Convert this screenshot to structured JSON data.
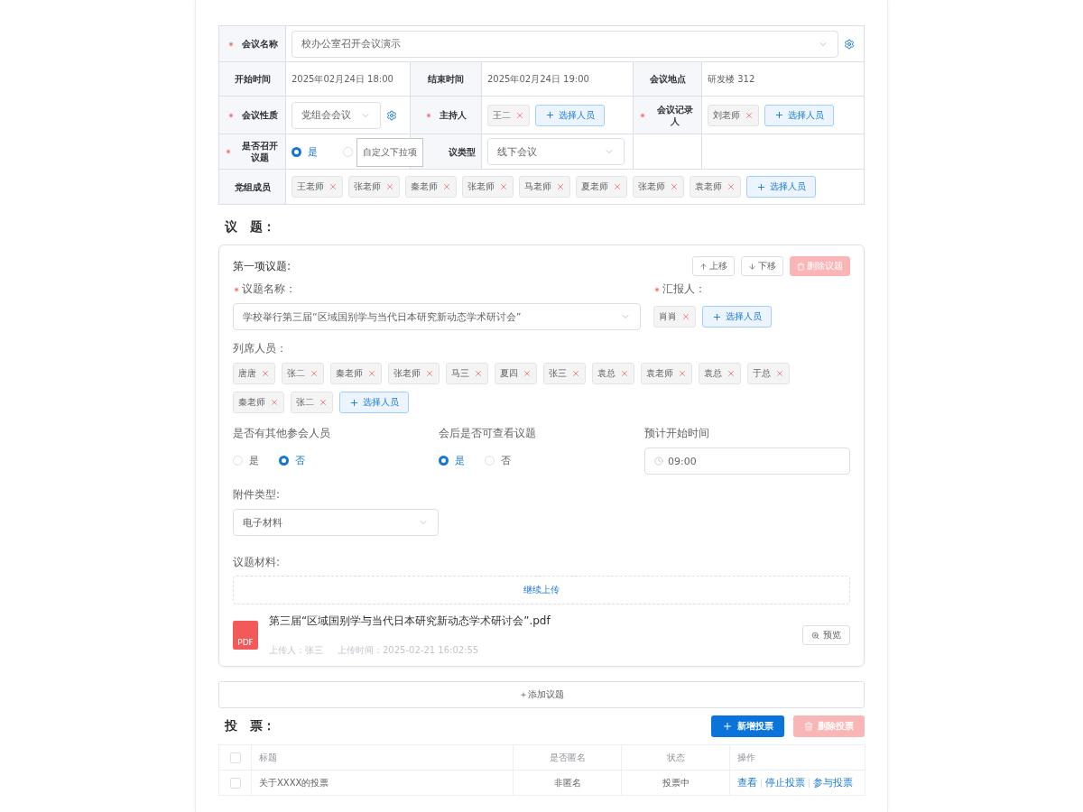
{
  "meeting": {
    "name": {
      "label": "会议名称",
      "required": true,
      "value": "校办公室召开会议演示"
    },
    "start_time": {
      "label": "开始时间",
      "value": "2025年02月24日 18:00"
    },
    "end_time": {
      "label": "结束时间",
      "value": "2025年02月24日 19:00"
    },
    "location": {
      "label": "会议地点",
      "value": "研发楼 312"
    },
    "nature": {
      "label": "会议性质",
      "required": true,
      "value": "党组会会议"
    },
    "host": {
      "label": "主持人",
      "required": true,
      "tags": [
        "王二"
      ],
      "button": "选择人员"
    },
    "recorder": {
      "label": "会议记录人",
      "required": true,
      "tags": [
        "刘老师"
      ],
      "button": "选择人员"
    },
    "has_topics": {
      "label": "是否召开议题",
      "required": true,
      "options": [
        {
          "label": "是",
          "selected": true
        },
        {
          "selected": false
        }
      ]
    },
    "tooltip": "自定义下拉项",
    "meeting_type": {
      "label": "议类型",
      "value": "线下会议"
    },
    "members": {
      "label": "党组成员",
      "tags": [
        "王老师",
        "张老师",
        "秦老师",
        "张老师",
        "马老师",
        "夏老师",
        "张老师",
        "袁老师"
      ],
      "button": "选择人员"
    }
  },
  "topics_heading": "议　题：",
  "topic": {
    "title": "第一项议题:",
    "buttons": [
      {
        "label": "上移",
        "kind": "up",
        "disabled": false
      },
      {
        "label": "下移",
        "kind": "down",
        "disabled": false
      },
      {
        "label": "删除议题",
        "kind": "delete",
        "disabled": true
      }
    ],
    "topic_name": {
      "label": "议题名称：",
      "required": true,
      "value": "学校举行第三届“区域国别学与当代日本研究新动态学术研讨会”"
    },
    "reporter": {
      "label": "汇报人：",
      "required": true,
      "tags": [
        "肖肖"
      ],
      "button": "选择人员"
    },
    "attendees": {
      "label": "列席人员：",
      "tags": [
        "唐唐",
        "张二",
        "秦老师",
        "张老师",
        "马三",
        "夏四",
        "张三",
        "袁总",
        "袁老师",
        "袁总",
        "于总",
        "秦老师",
        "张二"
      ],
      "button": "选择人员"
    },
    "other_attendees": {
      "label": "是否有其他参会人员",
      "options": [
        {
          "label": "是",
          "selected": false
        },
        {
          "label": "否",
          "selected": true
        }
      ]
    },
    "viewable": {
      "label": "会后是否可查看议题",
      "options": [
        {
          "label": "是",
          "selected": true
        },
        {
          "label": "否",
          "selected": false
        }
      ]
    },
    "planned_start": {
      "label": "预计开始时间",
      "value": "09:00"
    },
    "attachment_type": {
      "label": "附件类型:",
      "value": "电子材料"
    },
    "materials": {
      "label": "议题材料:",
      "upload": "继续上传",
      "file": {
        "badge": "PDF",
        "name": "第三届“区域国别学与当代日本研究新动态学术研讨会”.pdf",
        "uploader": "上传人：张三",
        "upload_time": "上传时间：2025-02-21 16:02:55",
        "preview": "预览"
      }
    }
  },
  "add_topic": "＋添加议题",
  "votes": {
    "heading": "投　票：",
    "buttons": [
      {
        "label": "新增投票",
        "kind": "add",
        "disabled": false
      },
      {
        "label": "删除投票",
        "kind": "delete",
        "disabled": true
      }
    ],
    "header_checked": false,
    "columns": [
      "标题",
      "是否匿名",
      "状态",
      "操作"
    ],
    "rows": [
      {
        "checked": false,
        "title": "关于XXXX的投票",
        "anonymous": "非匿名",
        "status": "投票中",
        "actions": [
          "查看",
          "停止投票",
          "参与投票"
        ]
      }
    ]
  }
}
